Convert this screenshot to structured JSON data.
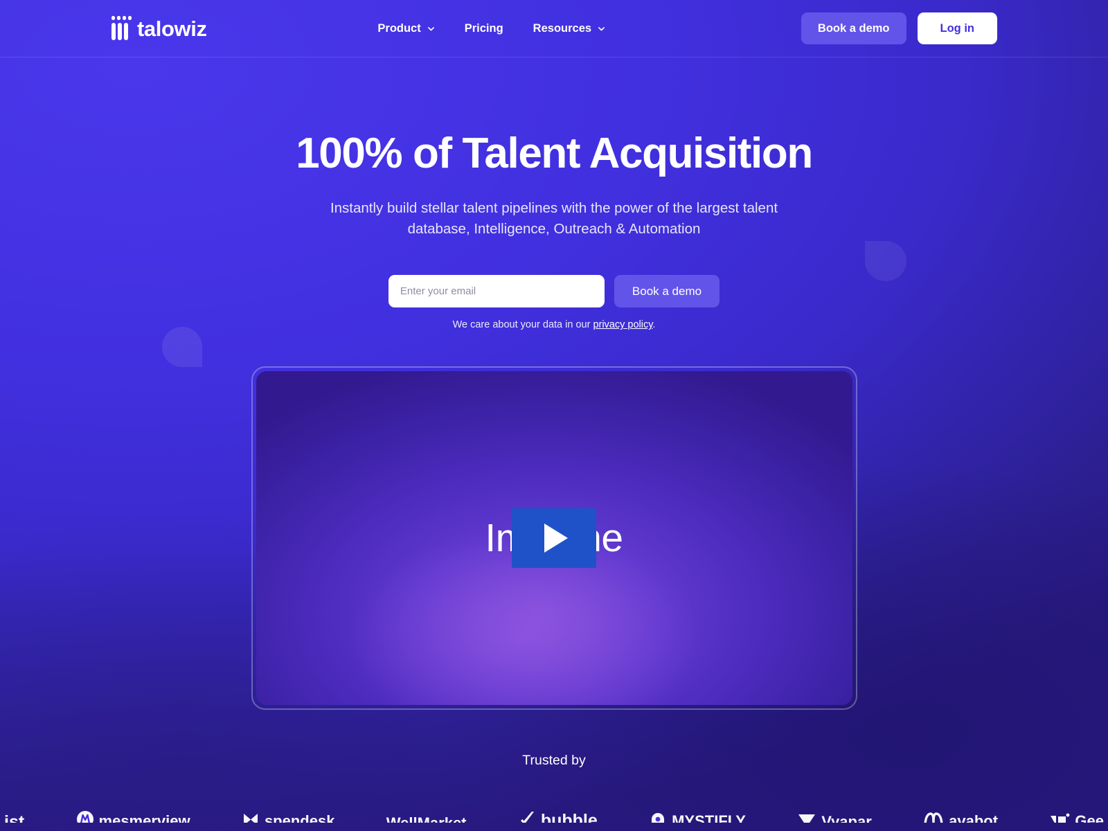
{
  "brand": {
    "name": "talowiz",
    "logo_icon": "talowiz-logo-icon",
    "dot_count": 4,
    "bar_count": 3
  },
  "colors": {
    "background": "#4130DF",
    "background_dark": "#2B1E8A",
    "accent_button": "#6254E8",
    "login_button_bg": "#FFFFFF",
    "login_button_text": "#4130DF",
    "play_button": "#1F52C8",
    "text_on_dark": "#FFFFFF"
  },
  "header": {
    "nav": [
      {
        "label": "Product",
        "has_dropdown": true,
        "icon": "chevron-down-icon"
      },
      {
        "label": "Pricing",
        "has_dropdown": false,
        "icon": ""
      },
      {
        "label": "Resources",
        "has_dropdown": true,
        "icon": "chevron-down-icon"
      }
    ],
    "book_demo_label": "Book a demo",
    "login_label": "Log in"
  },
  "hero": {
    "headline": "100% of Talent Acquisition",
    "subheadline": "Instantly build stellar talent pipelines with the power of the largest talent database, Intelligence, Outreach & Automation",
    "email_placeholder": "Enter your email",
    "email_value": "",
    "cta_label": "Book a demo",
    "privacy_prefix": "We care about your data in our ",
    "privacy_link": "privacy policy",
    "privacy_suffix": "."
  },
  "video": {
    "caption": "Imagine",
    "play_icon": "play-icon"
  },
  "trusted": {
    "label": "Trusted by",
    "logos": [
      {
        "name": "ist",
        "icon": ""
      },
      {
        "name": "mesmerview",
        "icon": "m-circle-icon"
      },
      {
        "name": "spendesk",
        "icon": "spendesk-mark-icon"
      },
      {
        "name": "WellMarket",
        "icon": ""
      },
      {
        "name": "bubble",
        "icon": "bubble-check-icon"
      },
      {
        "name": "MYSTIFLY",
        "icon": "mystifly-arch-icon"
      },
      {
        "name": "Vyapar",
        "icon": "vyapar-triangle-icon"
      },
      {
        "name": "avabot",
        "icon": "m-wave-icon"
      },
      {
        "name": "Gee",
        "icon": "gee-mark-icon"
      }
    ]
  }
}
